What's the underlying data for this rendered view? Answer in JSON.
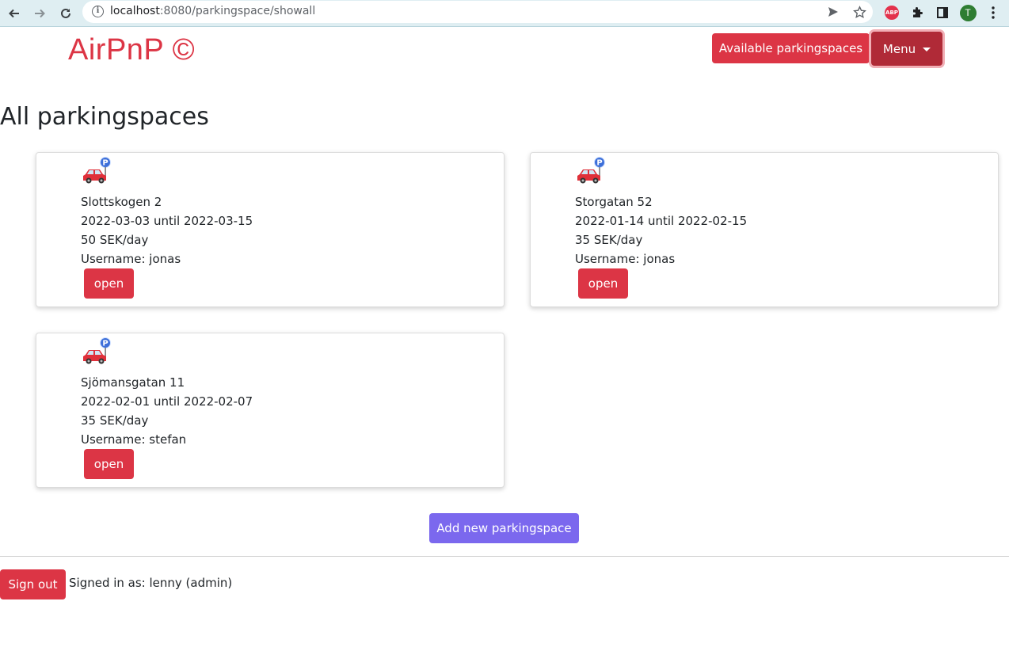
{
  "browser": {
    "url_host": "localhost",
    "url_rest": ":8080/parkingspace/showall",
    "profile_initial": "T",
    "abp_label": "ABP"
  },
  "header": {
    "brand": "AirPnP ©",
    "available_label": "Available parkingspaces",
    "menu_label": "Menu"
  },
  "page": {
    "title": "All parkingspaces"
  },
  "cards": [
    {
      "address": "Slottskogen 2",
      "dates": "2022-03-03 until 2022-03-15",
      "price": "50 SEK/day",
      "username": "Username: jonas",
      "open_label": "open"
    },
    {
      "address": "Storgatan 52",
      "dates": "2022-01-14 until 2022-02-15",
      "price": "35 SEK/day",
      "username": "Username: jonas",
      "open_label": "open"
    },
    {
      "address": "Sjömansgatan 11",
      "dates": "2022-02-01 until 2022-02-07",
      "price": "35 SEK/day",
      "username": "Username: stefan",
      "open_label": "open"
    }
  ],
  "actions": {
    "add_label": "Add new parkingspace"
  },
  "footer": {
    "signout_label": "Sign out",
    "signed_in_text": "Signed in as: lenny (admin)"
  },
  "colors": {
    "primary_red": "#dc3545",
    "menu_red": "#b02a37",
    "add_purple": "#7b68ee"
  },
  "icons": {
    "card_icon": "car-parking-icon"
  }
}
